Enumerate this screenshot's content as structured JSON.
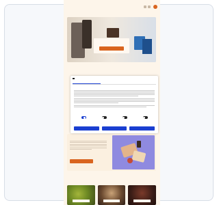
{
  "site": {
    "logo": "",
    "account_label": "",
    "hero_title": "",
    "section_heading_accent": "",
    "section_heading_rest": "",
    "promo_title": "",
    "shop_heading": ""
  },
  "consent": {
    "brand": "",
    "tabs": [
      {
        "label": "",
        "active": true
      },
      {
        "label": "",
        "active": false
      },
      {
        "label": "",
        "active": false
      }
    ],
    "heading": "",
    "toggles": [
      {
        "label": "",
        "on": true
      },
      {
        "label": "",
        "on": false
      },
      {
        "label": "",
        "on": false
      },
      {
        "label": "",
        "on": false
      }
    ],
    "buttons": [
      "",
      "",
      ""
    ]
  },
  "tiles": [
    "",
    "",
    ""
  ],
  "colors": {
    "accent": "#d9641e",
    "consent_blue": "#1a3fd1",
    "page_bg": "#fdf5ea"
  },
  "icons": [
    "search-icon",
    "account-icon",
    "cart-icon"
  ]
}
